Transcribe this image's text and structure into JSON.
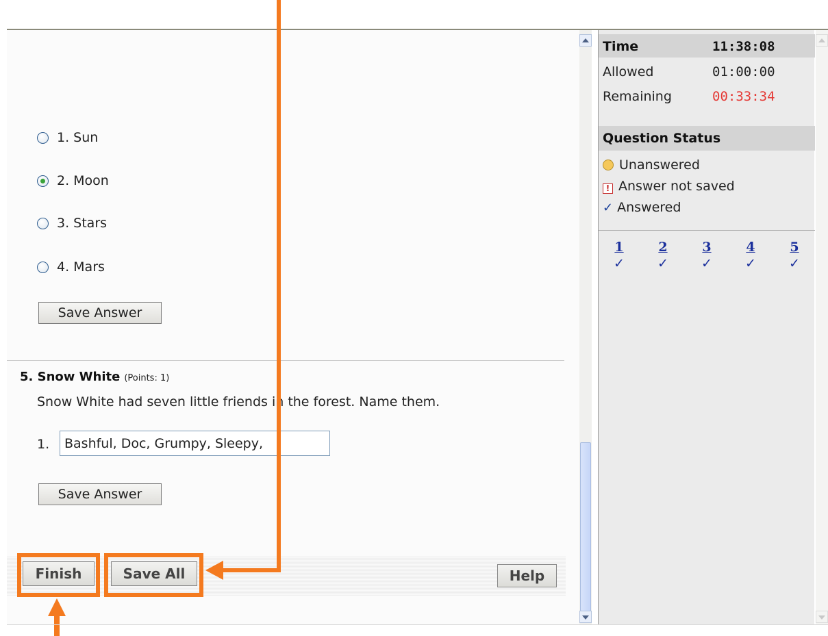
{
  "question4": {
    "options": [
      {
        "label": "1. Sun",
        "selected": false
      },
      {
        "label": "2. Moon",
        "selected": true
      },
      {
        "label": "3. Stars",
        "selected": false
      },
      {
        "label": "4. Mars",
        "selected": false
      }
    ],
    "save_label": "Save Answer"
  },
  "question5": {
    "title": "5. Snow White",
    "points": "(Points: 1)",
    "prompt": "Snow White had seven little friends in the forest. Name them.",
    "answer_number": "1.",
    "answer_value": "Bashful, Doc, Grumpy, Sleepy,",
    "save_label": "Save Answer"
  },
  "footer": {
    "finish_label": "Finish",
    "save_all_label": "Save All",
    "help_label": "Help"
  },
  "timer": {
    "time_label": "Time",
    "time_value": "11:38:08",
    "allowed_label": "Allowed",
    "allowed_value": "01:00:00",
    "remaining_label": "Remaining",
    "remaining_value": "00:33:34"
  },
  "status": {
    "heading": "Question Status",
    "legend": {
      "unanswered": "Unanswered",
      "not_saved": "Answer not saved",
      "answered": "Answered"
    },
    "questions": [
      {
        "number": "1",
        "mark": "✓"
      },
      {
        "number": "2",
        "mark": "✓"
      },
      {
        "number": "3",
        "mark": "✓"
      },
      {
        "number": "4",
        "mark": "✓"
      },
      {
        "number": "5",
        "mark": "✓"
      }
    ]
  },
  "colors": {
    "highlight": "#f47a1f",
    "remaining_text": "#e53935",
    "link": "#1a2f9c"
  },
  "icons": {
    "warning": "!",
    "check": "✓"
  }
}
